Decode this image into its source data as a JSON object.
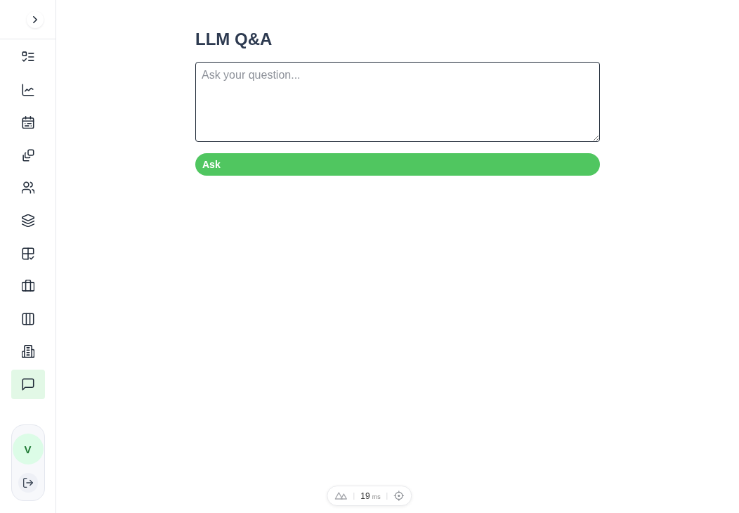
{
  "sidebar": {
    "items": [
      {
        "selected": false
      },
      {
        "selected": false
      },
      {
        "selected": false
      },
      {
        "selected": false
      },
      {
        "selected": false
      },
      {
        "selected": false
      },
      {
        "selected": false
      },
      {
        "selected": false
      },
      {
        "selected": false
      },
      {
        "selected": false
      },
      {
        "selected": true
      }
    ],
    "user": {
      "initial": "V"
    }
  },
  "main": {
    "title": "LLM Q&A",
    "question": {
      "placeholder": "Ask your question..."
    },
    "ask_button": {
      "label": "Ask"
    }
  },
  "perf_badge": {
    "value": "19",
    "unit": "ms"
  }
}
